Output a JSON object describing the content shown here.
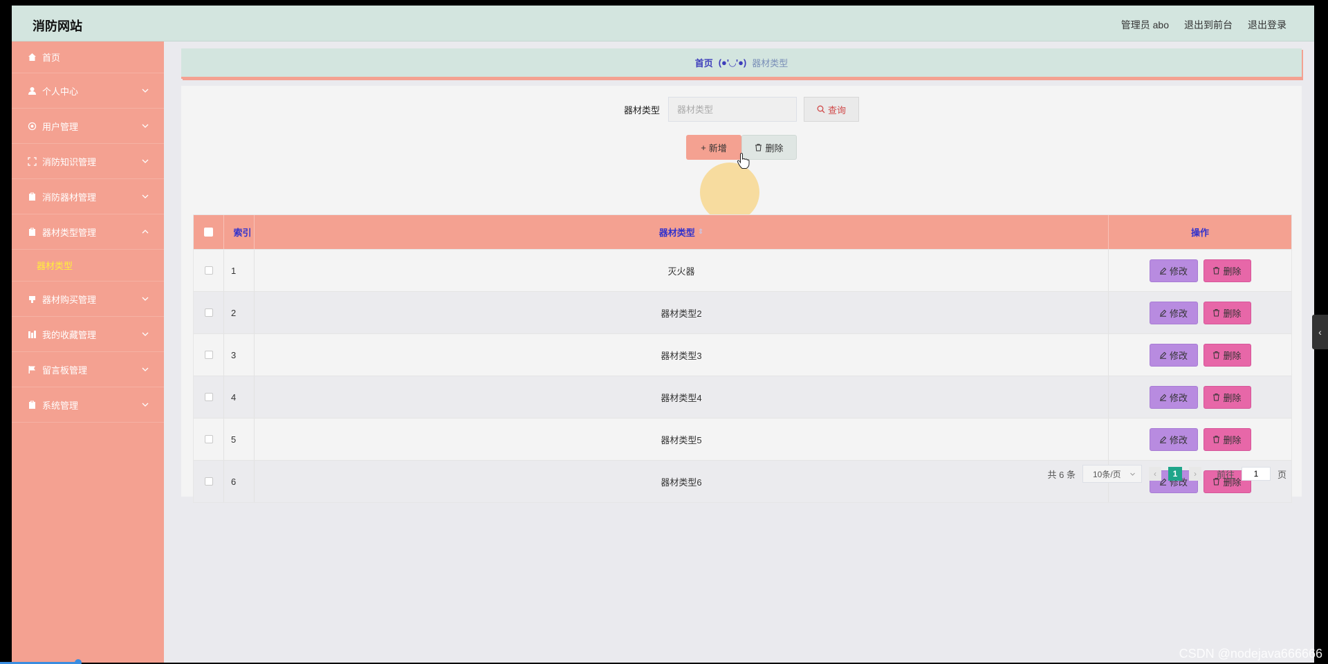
{
  "header": {
    "brand": "消防网站",
    "admin_label": "管理员 abo",
    "front_label": "退出到前台",
    "logout_label": "退出登录"
  },
  "sidebar": {
    "items": [
      {
        "label": "首页",
        "icon": "home-icon"
      },
      {
        "label": "个人中心",
        "icon": "user-icon"
      },
      {
        "label": "用户管理",
        "icon": "settings-icon"
      },
      {
        "label": "消防知识管理",
        "icon": "fullscreen-icon"
      },
      {
        "label": "消防器材管理",
        "icon": "clipboard-icon"
      },
      {
        "label": "器材类型管理",
        "icon": "clipboard-icon"
      },
      {
        "label": "器材购买管理",
        "icon": "cart-icon"
      },
      {
        "label": "我的收藏管理",
        "icon": "books-icon"
      },
      {
        "label": "留言板管理",
        "icon": "flag-icon"
      },
      {
        "label": "系统管理",
        "icon": "clipboard-icon"
      }
    ],
    "active_sub": "器材类型"
  },
  "breadcrumb": {
    "home": "首页",
    "separator": "(●'◡'●)",
    "current": "器材类型"
  },
  "search": {
    "label": "器材类型",
    "placeholder": "器材类型",
    "query_label": "查询"
  },
  "actions": {
    "add_label": "新增",
    "delete_label": "删除"
  },
  "table": {
    "headers": {
      "index": "索引",
      "type": "器材类型",
      "ops": "操作"
    },
    "edit_label": "修改",
    "remove_label": "删除",
    "rows": [
      {
        "index": "1",
        "type": "灭火器"
      },
      {
        "index": "2",
        "type": "器材类型2"
      },
      {
        "index": "3",
        "type": "器材类型3"
      },
      {
        "index": "4",
        "type": "器材类型4"
      },
      {
        "index": "5",
        "type": "器材类型5"
      },
      {
        "index": "6",
        "type": "器材类型6"
      }
    ]
  },
  "pagination": {
    "total": "共 6 条",
    "page_size": "10条/页",
    "current_page": "1",
    "goto_label": "前往",
    "goto_value": "1",
    "page_unit": "页"
  },
  "watermark": "CSDN @nodejava666666",
  "colors": {
    "header_bg": "#d3e5df",
    "sidebar_bg": "#f4a191",
    "active_sub": "#ffef3a",
    "edit_btn": "#b88be0",
    "remove_btn": "#e767a8",
    "page_active": "#1fa58a"
  }
}
